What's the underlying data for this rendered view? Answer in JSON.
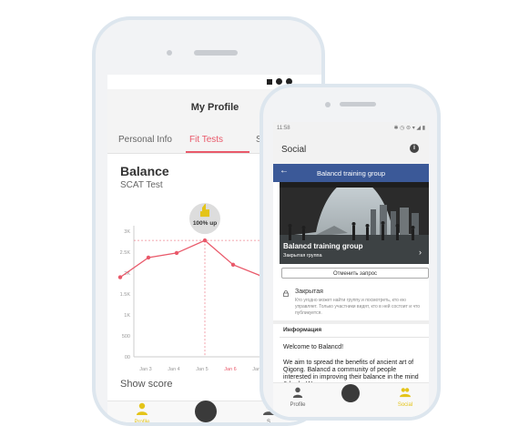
{
  "colors": {
    "accent": "#e9596a",
    "facebook_blue": "#3b5998",
    "nav_active": "#e4c419"
  },
  "back_phone": {
    "title": "My Profile",
    "tabs": [
      "Personal Info",
      "Fit Tests",
      "Se"
    ],
    "active_tab": "Fit Tests",
    "heading": "Balance",
    "subheading": "SCAT Test",
    "badge_label": "100% up",
    "show_score": "Show score",
    "nav": {
      "profile": "Profile",
      "settings": "S"
    },
    "chart_data": {
      "type": "line",
      "categories": [
        "Jan 3",
        "Jan 4",
        "Jan 5",
        "Jan 6",
        "Jan 7"
      ],
      "highlighted_category": "Jan 6",
      "series": [
        {
          "values": [
            1900,
            2370,
            2480,
            2780,
            2200,
            1930
          ]
        }
      ],
      "y_ticks": [
        "3K",
        "2.5K",
        "2K",
        "1.5K",
        "1K",
        "500",
        "00"
      ],
      "ylim": [
        0,
        3000
      ],
      "grid": false
    }
  },
  "front_phone": {
    "status_time": "11:58",
    "status_icons": "✱ ◷ ⊜ ▾ ◢ ▮",
    "title": "Social",
    "group_bar_title": "Balancd training group",
    "group_name": "Balancd training group",
    "group_type": "Закрытая группа",
    "cancel_request": "Отменить запрос",
    "closed_title": "Закрытая",
    "closed_desc": "Кто угодно может найти группу и посмотреть, кто ею управляет. Только участники видят, кто в ней состоит и что публикуется.",
    "info_header": "Информация",
    "welcome": "Welcome to Balancd!",
    "body": "We aim to spread the benefits of ancient art of Qigong. Balancd a community of people interested in improving their balance in the mind & body. We are a",
    "nav": {
      "profile": "Profile",
      "social": "Social"
    }
  }
}
